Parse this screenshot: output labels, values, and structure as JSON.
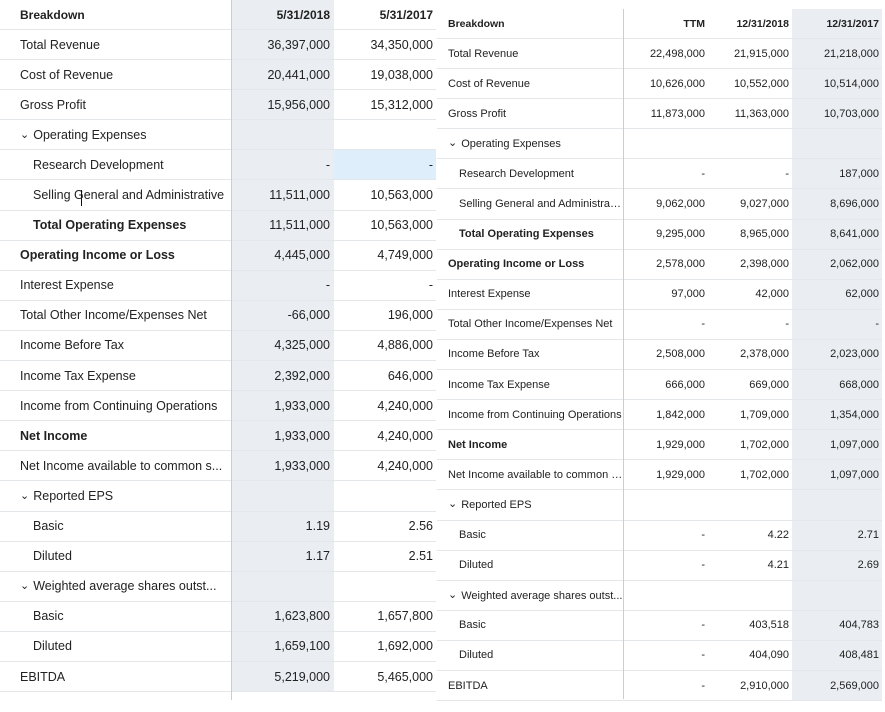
{
  "left": {
    "header": {
      "label": "Breakdown",
      "cols": [
        "5/31/2018",
        "5/31/2017"
      ]
    },
    "rows": [
      {
        "label": "Total Revenue",
        "vals": [
          "36,397,000",
          "34,350,000"
        ]
      },
      {
        "label": "Cost of Revenue",
        "vals": [
          "20,441,000",
          "19,038,000"
        ]
      },
      {
        "label": "Gross Profit",
        "vals": [
          "15,956,000",
          "15,312,000"
        ]
      },
      {
        "label": "Operating Expenses",
        "vals": [
          "",
          ""
        ]
      },
      {
        "label": "Research Development",
        "vals": [
          "-",
          "-"
        ]
      },
      {
        "label": "Selling General and Administrative",
        "vals": [
          "11,511,000",
          "10,563,000"
        ]
      },
      {
        "label": "Total Operating Expenses",
        "vals": [
          "11,511,000",
          "10,563,000"
        ]
      },
      {
        "label": "Operating Income or Loss",
        "vals": [
          "4,445,000",
          "4,749,000"
        ]
      },
      {
        "label": "Interest Expense",
        "vals": [
          "-",
          "-"
        ]
      },
      {
        "label": "Total Other Income/Expenses Net",
        "vals": [
          "-66,000",
          "196,000"
        ]
      },
      {
        "label": "Income Before Tax",
        "vals": [
          "4,325,000",
          "4,886,000"
        ]
      },
      {
        "label": "Income Tax Expense",
        "vals": [
          "2,392,000",
          "646,000"
        ]
      },
      {
        "label": "Income from Continuing Operations",
        "vals": [
          "1,933,000",
          "4,240,000"
        ]
      },
      {
        "label": "Net Income",
        "vals": [
          "1,933,000",
          "4,240,000"
        ]
      },
      {
        "label": "Net Income available to common s...",
        "vals": [
          "1,933,000",
          "4,240,000"
        ]
      },
      {
        "label": "Reported EPS",
        "vals": [
          "",
          ""
        ]
      },
      {
        "label": "Basic",
        "vals": [
          "1.19",
          "2.56"
        ]
      },
      {
        "label": "Diluted",
        "vals": [
          "1.17",
          "2.51"
        ]
      },
      {
        "label": "Weighted average shares outst...",
        "vals": [
          "",
          ""
        ]
      },
      {
        "label": "Basic",
        "vals": [
          "1,623,800",
          "1,657,800"
        ]
      },
      {
        "label": "Diluted",
        "vals": [
          "1,659,100",
          "1,692,000"
        ]
      },
      {
        "label": "EBITDA",
        "vals": [
          "5,219,000",
          "5,465,000"
        ]
      }
    ]
  },
  "right": {
    "header": {
      "label": "Breakdown",
      "cols": [
        "TTM",
        "12/31/2018",
        "12/31/2017"
      ]
    },
    "rows": [
      {
        "label": "Total Revenue",
        "vals": [
          "22,498,000",
          "21,915,000",
          "21,218,000"
        ]
      },
      {
        "label": "Cost of Revenue",
        "vals": [
          "10,626,000",
          "10,552,000",
          "10,514,000"
        ]
      },
      {
        "label": "Gross Profit",
        "vals": [
          "11,873,000",
          "11,363,000",
          "10,703,000"
        ]
      },
      {
        "label": "Operating Expenses",
        "vals": [
          "",
          "",
          ""
        ]
      },
      {
        "label": "Research Development",
        "vals": [
          "-",
          "-",
          "187,000"
        ]
      },
      {
        "label": "Selling General and Administrative",
        "vals": [
          "9,062,000",
          "9,027,000",
          "8,696,000"
        ]
      },
      {
        "label": "Total Operating Expenses",
        "vals": [
          "9,295,000",
          "8,965,000",
          "8,641,000"
        ]
      },
      {
        "label": "Operating Income or Loss",
        "vals": [
          "2,578,000",
          "2,398,000",
          "2,062,000"
        ]
      },
      {
        "label": "Interest Expense",
        "vals": [
          "97,000",
          "42,000",
          "62,000"
        ]
      },
      {
        "label": "Total Other Income/Expenses Net",
        "vals": [
          "-",
          "-",
          "-"
        ]
      },
      {
        "label": "Income Before Tax",
        "vals": [
          "2,508,000",
          "2,378,000",
          "2,023,000"
        ]
      },
      {
        "label": "Income Tax Expense",
        "vals": [
          "666,000",
          "669,000",
          "668,000"
        ]
      },
      {
        "label": "Income from Continuing Operations",
        "vals": [
          "1,842,000",
          "1,709,000",
          "1,354,000"
        ]
      },
      {
        "label": "Net Income",
        "vals": [
          "1,929,000",
          "1,702,000",
          "1,097,000"
        ]
      },
      {
        "label": "Net Income available to common s...",
        "vals": [
          "1,929,000",
          "1,702,000",
          "1,097,000"
        ]
      },
      {
        "label": "Reported EPS",
        "vals": [
          "",
          "",
          ""
        ]
      },
      {
        "label": "Basic",
        "vals": [
          "-",
          "4.22",
          "2.71"
        ]
      },
      {
        "label": "Diluted",
        "vals": [
          "-",
          "4.21",
          "2.69"
        ]
      },
      {
        "label": "Weighted average shares outst...",
        "vals": [
          "",
          "",
          ""
        ]
      },
      {
        "label": "Basic",
        "vals": [
          "-",
          "403,518",
          "404,783"
        ]
      },
      {
        "label": "Diluted",
        "vals": [
          "-",
          "404,090",
          "408,481"
        ]
      },
      {
        "label": "EBITDA",
        "vals": [
          "-",
          "2,910,000",
          "2,569,000"
        ]
      }
    ]
  }
}
